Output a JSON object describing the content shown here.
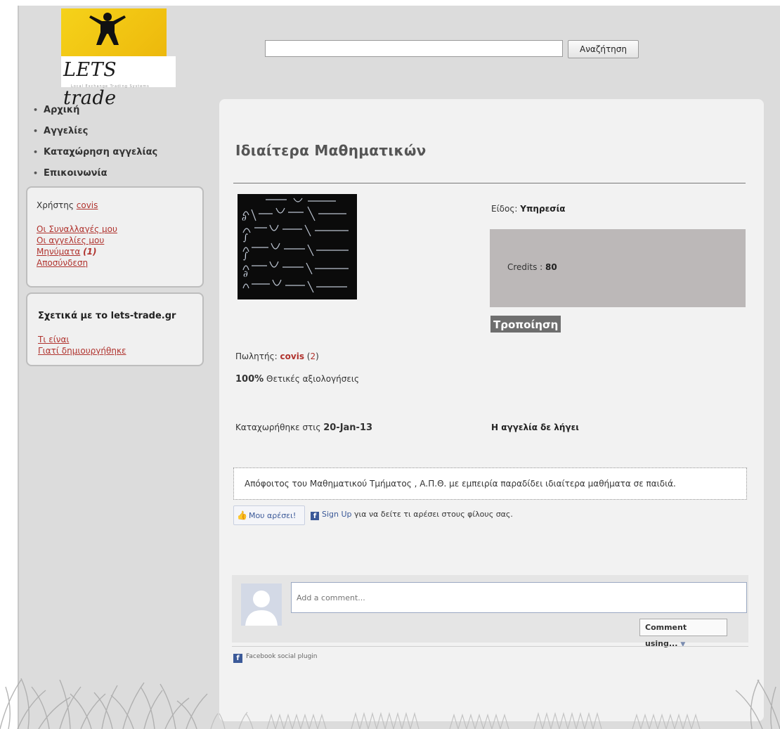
{
  "header": {
    "logo_text": "LETS trade",
    "logo_tagline": "Local Exchange Trading Systems",
    "search_value": "",
    "search_button": "Αναζήτηση"
  },
  "nav": {
    "items": [
      "Αρχική",
      "Αγγελίες",
      "Καταχώρηση αγγελίας",
      "Επικοινωνία"
    ]
  },
  "user_box": {
    "user_label": "Χρήστης",
    "username": "covis",
    "links": {
      "transactions": "Οι Συναλλαγές μου",
      "listings": "Οι αγγελίες μου",
      "messages": "Μηνύματα",
      "messages_count": "(1)",
      "logout": "Αποσύνδεση"
    }
  },
  "about_box": {
    "title": "Σχετικά με το lets-trade.gr",
    "links": [
      "Τι είναι",
      "Γιατί δημιουργήθηκε"
    ]
  },
  "listing": {
    "title": "Ιδιαίτερα Μαθηματικών",
    "type_label": "Είδος:",
    "type_value": "Υπηρεσία",
    "credits_label": "Credits :",
    "credits_value": "80",
    "edit_button": "Τροποίηση",
    "seller_label": "Πωλητής:",
    "seller_name": "covis",
    "seller_count": "2",
    "rating_value": "100%",
    "rating_label": "Θετικές αξιολογήσεις",
    "date_label": "Καταχωρήθηκε στις",
    "date_value": "20-Jan-13",
    "expiry": "Η αγγελία δε λήγει",
    "description": "Απόφοιτος του Μαθηματικού Τμήματος , Α.Π.Θ. με εμπειρία παραδίδει ιδιαίτερα μαθήματα σε παιδιά."
  },
  "social": {
    "like_button": "Μου αρέσει!",
    "signup_link": "Sign Up",
    "signup_text": "για να δείτε τι αρέσει στους φίλους σας.",
    "comment_placeholder": "Add a comment...",
    "comment_using": "Comment using...",
    "plugin_label": "Facebook social plugin"
  },
  "colors": {
    "page_bg": "#dcdcdc",
    "content_bg": "#f2f2f2",
    "link": "#b0332e",
    "credits_bg": "#bcb8b8",
    "button_bg": "#6e6e6e",
    "facebook": "#3b5998",
    "logo_yellow": "#f5d21a"
  }
}
